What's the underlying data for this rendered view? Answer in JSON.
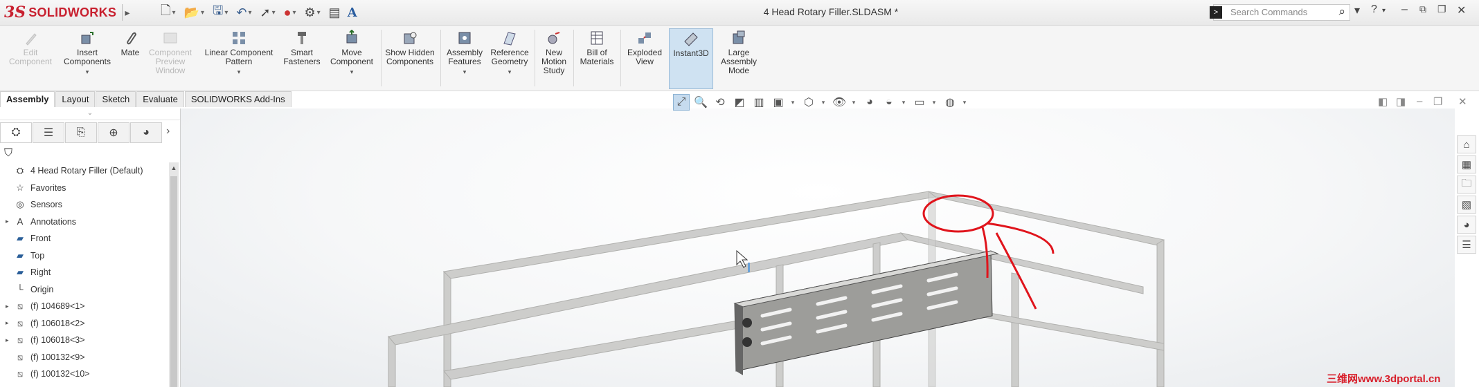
{
  "app": {
    "logo_prefix": "3S",
    "logo_name": "SOLIDWORKS",
    "document_title": "4 Head Rotary Filler.SLDASM *"
  },
  "search": {
    "placeholder": "Search Commands"
  },
  "ribbon": {
    "edit_component": "Edit Component",
    "insert_components": "Insert Components",
    "mate": "Mate",
    "component_preview": "Component Preview Window",
    "linear_pattern": "Linear Component Pattern",
    "smart_fasteners": "Smart Fasteners",
    "move_component": "Move Component",
    "show_hidden": "Show Hidden Components",
    "assembly_features": "Assembly Features",
    "reference_geometry": "Reference Geometry",
    "new_motion_study": "New Motion Study",
    "bill_of_materials": "Bill of Materials",
    "exploded_view": "Exploded View",
    "instant3d": "Instant3D",
    "large_assembly_mode": "Large Assembly Mode"
  },
  "tabs": [
    "Assembly",
    "Layout",
    "Sketch",
    "Evaluate",
    "SOLIDWORKS Add-Ins"
  ],
  "tree": [
    {
      "label": "4 Head Rotary Filler  (Default)",
      "icon": "assembly-icon",
      "exp": ""
    },
    {
      "label": "Favorites",
      "icon": "star-icon",
      "exp": ""
    },
    {
      "label": "Sensors",
      "icon": "sensor-icon",
      "exp": ""
    },
    {
      "label": "Annotations",
      "icon": "annotation-icon",
      "exp": "▸"
    },
    {
      "label": "Front",
      "icon": "plane-icon",
      "exp": ""
    },
    {
      "label": "Top",
      "icon": "plane-icon",
      "exp": ""
    },
    {
      "label": "Right",
      "icon": "plane-icon",
      "exp": ""
    },
    {
      "label": "Origin",
      "icon": "origin-icon",
      "exp": ""
    },
    {
      "label": "(f) 104689<1>",
      "icon": "part-icon",
      "exp": "▸"
    },
    {
      "label": "(f) 106018<2>",
      "icon": "part-icon",
      "exp": "▸"
    },
    {
      "label": "(f) 106018<3>",
      "icon": "part-icon",
      "exp": "▸"
    },
    {
      "label": "(f) 100132<9>",
      "icon": "part-icon",
      "exp": ""
    },
    {
      "label": "(f) 100132<10>",
      "icon": "part-icon",
      "exp": ""
    }
  ],
  "watermark": "三维网www.3dportal.cn",
  "colors": {
    "brand_red": "#c8202f",
    "annotation_red": "#e0141c",
    "highlight": "#cfe2f2"
  }
}
